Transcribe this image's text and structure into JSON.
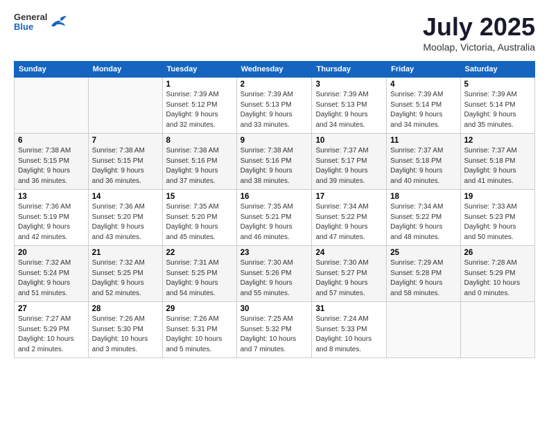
{
  "header": {
    "logo_general": "General",
    "logo_blue": "Blue",
    "title": "July 2025",
    "location": "Moolap, Victoria, Australia"
  },
  "days_of_week": [
    "Sunday",
    "Monday",
    "Tuesday",
    "Wednesday",
    "Thursday",
    "Friday",
    "Saturday"
  ],
  "weeks": [
    [
      {
        "day": "",
        "info": ""
      },
      {
        "day": "",
        "info": ""
      },
      {
        "day": "1",
        "info": "Sunrise: 7:39 AM\nSunset: 5:12 PM\nDaylight: 9 hours\nand 32 minutes."
      },
      {
        "day": "2",
        "info": "Sunrise: 7:39 AM\nSunset: 5:13 PM\nDaylight: 9 hours\nand 33 minutes."
      },
      {
        "day": "3",
        "info": "Sunrise: 7:39 AM\nSunset: 5:13 PM\nDaylight: 9 hours\nand 34 minutes."
      },
      {
        "day": "4",
        "info": "Sunrise: 7:39 AM\nSunset: 5:14 PM\nDaylight: 9 hours\nand 34 minutes."
      },
      {
        "day": "5",
        "info": "Sunrise: 7:39 AM\nSunset: 5:14 PM\nDaylight: 9 hours\nand 35 minutes."
      }
    ],
    [
      {
        "day": "6",
        "info": "Sunrise: 7:38 AM\nSunset: 5:15 PM\nDaylight: 9 hours\nand 36 minutes."
      },
      {
        "day": "7",
        "info": "Sunrise: 7:38 AM\nSunset: 5:15 PM\nDaylight: 9 hours\nand 36 minutes."
      },
      {
        "day": "8",
        "info": "Sunrise: 7:38 AM\nSunset: 5:16 PM\nDaylight: 9 hours\nand 37 minutes."
      },
      {
        "day": "9",
        "info": "Sunrise: 7:38 AM\nSunset: 5:16 PM\nDaylight: 9 hours\nand 38 minutes."
      },
      {
        "day": "10",
        "info": "Sunrise: 7:37 AM\nSunset: 5:17 PM\nDaylight: 9 hours\nand 39 minutes."
      },
      {
        "day": "11",
        "info": "Sunrise: 7:37 AM\nSunset: 5:18 PM\nDaylight: 9 hours\nand 40 minutes."
      },
      {
        "day": "12",
        "info": "Sunrise: 7:37 AM\nSunset: 5:18 PM\nDaylight: 9 hours\nand 41 minutes."
      }
    ],
    [
      {
        "day": "13",
        "info": "Sunrise: 7:36 AM\nSunset: 5:19 PM\nDaylight: 9 hours\nand 42 minutes."
      },
      {
        "day": "14",
        "info": "Sunrise: 7:36 AM\nSunset: 5:20 PM\nDaylight: 9 hours\nand 43 minutes."
      },
      {
        "day": "15",
        "info": "Sunrise: 7:35 AM\nSunset: 5:20 PM\nDaylight: 9 hours\nand 45 minutes."
      },
      {
        "day": "16",
        "info": "Sunrise: 7:35 AM\nSunset: 5:21 PM\nDaylight: 9 hours\nand 46 minutes."
      },
      {
        "day": "17",
        "info": "Sunrise: 7:34 AM\nSunset: 5:22 PM\nDaylight: 9 hours\nand 47 minutes."
      },
      {
        "day": "18",
        "info": "Sunrise: 7:34 AM\nSunset: 5:22 PM\nDaylight: 9 hours\nand 48 minutes."
      },
      {
        "day": "19",
        "info": "Sunrise: 7:33 AM\nSunset: 5:23 PM\nDaylight: 9 hours\nand 50 minutes."
      }
    ],
    [
      {
        "day": "20",
        "info": "Sunrise: 7:32 AM\nSunset: 5:24 PM\nDaylight: 9 hours\nand 51 minutes."
      },
      {
        "day": "21",
        "info": "Sunrise: 7:32 AM\nSunset: 5:25 PM\nDaylight: 9 hours\nand 52 minutes."
      },
      {
        "day": "22",
        "info": "Sunrise: 7:31 AM\nSunset: 5:25 PM\nDaylight: 9 hours\nand 54 minutes."
      },
      {
        "day": "23",
        "info": "Sunrise: 7:30 AM\nSunset: 5:26 PM\nDaylight: 9 hours\nand 55 minutes."
      },
      {
        "day": "24",
        "info": "Sunrise: 7:30 AM\nSunset: 5:27 PM\nDaylight: 9 hours\nand 57 minutes."
      },
      {
        "day": "25",
        "info": "Sunrise: 7:29 AM\nSunset: 5:28 PM\nDaylight: 9 hours\nand 58 minutes."
      },
      {
        "day": "26",
        "info": "Sunrise: 7:28 AM\nSunset: 5:29 PM\nDaylight: 10 hours\nand 0 minutes."
      }
    ],
    [
      {
        "day": "27",
        "info": "Sunrise: 7:27 AM\nSunset: 5:29 PM\nDaylight: 10 hours\nand 2 minutes."
      },
      {
        "day": "28",
        "info": "Sunrise: 7:26 AM\nSunset: 5:30 PM\nDaylight: 10 hours\nand 3 minutes."
      },
      {
        "day": "29",
        "info": "Sunrise: 7:26 AM\nSunset: 5:31 PM\nDaylight: 10 hours\nand 5 minutes."
      },
      {
        "day": "30",
        "info": "Sunrise: 7:25 AM\nSunset: 5:32 PM\nDaylight: 10 hours\nand 7 minutes."
      },
      {
        "day": "31",
        "info": "Sunrise: 7:24 AM\nSunset: 5:33 PM\nDaylight: 10 hours\nand 8 minutes."
      },
      {
        "day": "",
        "info": ""
      },
      {
        "day": "",
        "info": ""
      }
    ]
  ]
}
